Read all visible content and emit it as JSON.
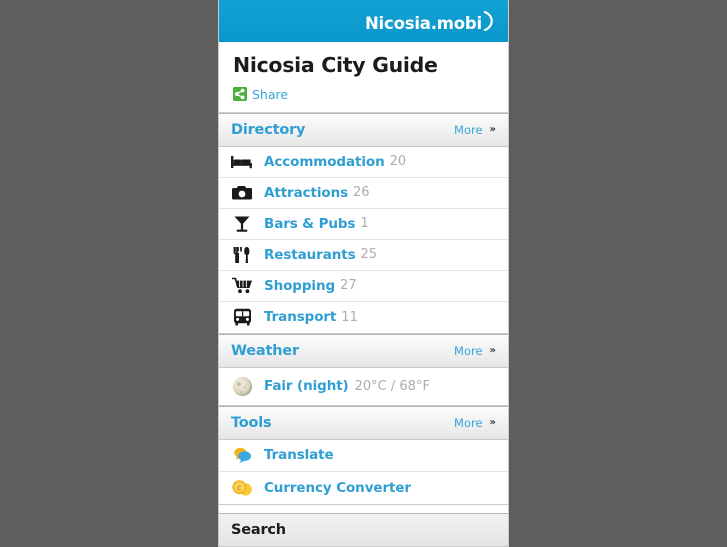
{
  "brand": {
    "logo_text": "Nicosia",
    "logo_suffix": ".mobi",
    "header_color": "#0d9dd1"
  },
  "header": {
    "title": "Nicosia City Guide",
    "share_label": "Share"
  },
  "more_label": "More",
  "more_chevron": "»",
  "sections": [
    {
      "id": "directory",
      "title": "Directory",
      "items": [
        {
          "icon": "bed-icon",
          "label": "Accommodation",
          "count": "20"
        },
        {
          "icon": "camera-icon",
          "label": "Attractions",
          "count": "26"
        },
        {
          "icon": "cocktail-icon",
          "label": "Bars & Pubs",
          "count": "1"
        },
        {
          "icon": "cutlery-icon",
          "label": "Restaurants",
          "count": "25"
        },
        {
          "icon": "cart-icon",
          "label": "Shopping",
          "count": "27"
        },
        {
          "icon": "bus-icon",
          "label": "Transport",
          "count": "11"
        }
      ]
    },
    {
      "id": "weather",
      "title": "Weather",
      "items": [
        {
          "icon": "moon-icon",
          "label": "Fair (night)",
          "detail": "20°C / 68°F"
        }
      ]
    },
    {
      "id": "tools",
      "title": "Tools",
      "items": [
        {
          "icon": "speech-bubbles-icon",
          "label": "Translate"
        },
        {
          "icon": "coins-icon",
          "label": "Currency Converter"
        }
      ]
    },
    {
      "id": "search",
      "title": "Search",
      "items": []
    }
  ],
  "colors": {
    "accent_blue": "#2f9ed2",
    "link_blue": "#3aa3d6",
    "count_gray": "#adadad",
    "page_background": "#5e5e5e",
    "share_green": "#4caf3f"
  }
}
